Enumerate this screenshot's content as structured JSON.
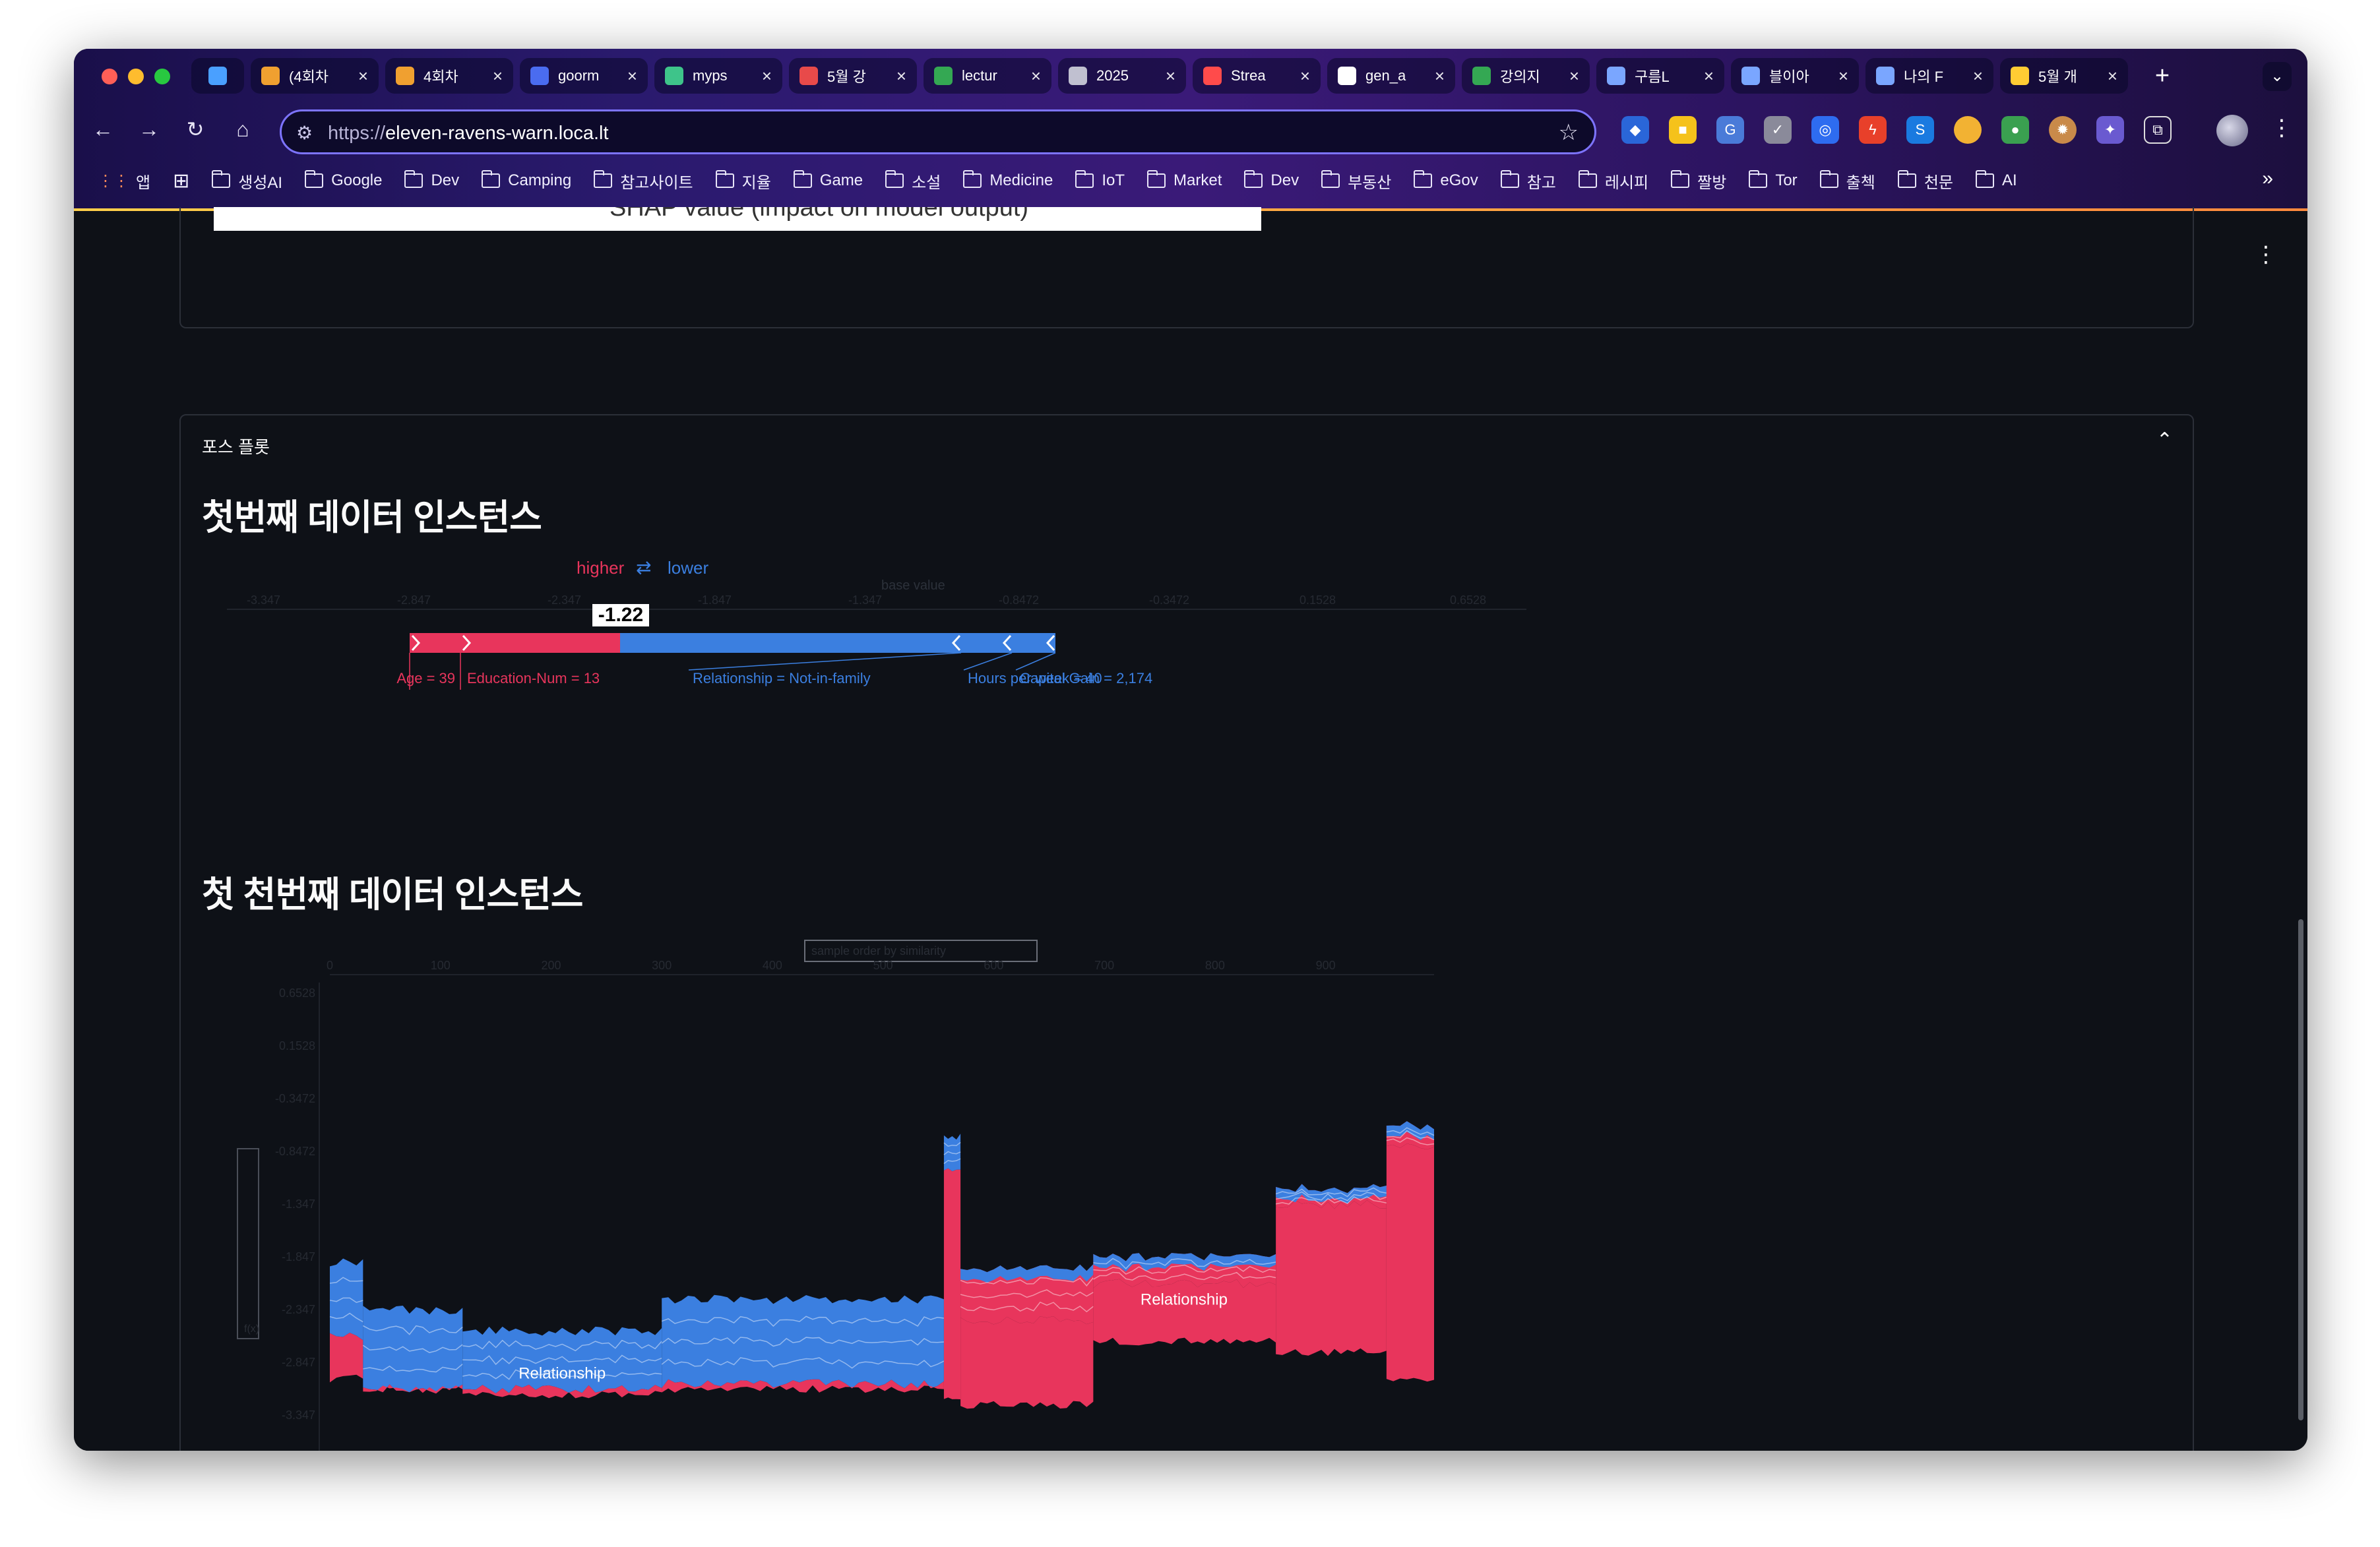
{
  "browser": {
    "tabs": [
      {
        "title": "",
        "icon_color": "#4aa0ff",
        "icon": "gem-icon",
        "pinned": true
      },
      {
        "title": "(4회차",
        "icon_color": "#f0a030",
        "icon": "cube-icon"
      },
      {
        "title": "4회차",
        "icon_color": "#f0a030",
        "icon": "cube-icon"
      },
      {
        "title": "goorm",
        "icon_color": "#4a6cf0",
        "icon": "goorm-icon"
      },
      {
        "title": "myps",
        "icon_color": "#3ec48a",
        "icon": "v-icon"
      },
      {
        "title": "5월 강",
        "icon_color": "#e84a4a",
        "icon": "hundred-icon"
      },
      {
        "title": "lectur",
        "icon_color": "#34a853",
        "icon": "drive-icon"
      },
      {
        "title": "2025",
        "icon_color": "#c0c0d0",
        "icon": "infinity-icon"
      },
      {
        "title": "Strea",
        "icon_color": "#ff4b4b",
        "icon": "crown-icon"
      },
      {
        "title": "gen_a",
        "icon_color": "#ffffff",
        "icon": "github-icon"
      },
      {
        "title": "강의지",
        "icon_color": "#34a853",
        "icon": "drive-icon"
      },
      {
        "title": "구름L",
        "icon_color": "#7aa6ff",
        "icon": "arrow-icon"
      },
      {
        "title": "블이아",
        "icon_color": "#7aa6ff",
        "icon": "arrow-icon"
      },
      {
        "title": "나의 F",
        "icon_color": "#7aa6ff",
        "icon": "arrow-icon"
      },
      {
        "title": "5월 개",
        "icon_color": "#ffcc33",
        "icon": "emoji-icon"
      }
    ],
    "close_glyph": "×",
    "new_tab_glyph": "+",
    "url_protocol": "https://",
    "url_host": "eleven-ravens-warn.loca.lt",
    "bookmarks": [
      "앱",
      "",
      "생성AI",
      "Google",
      "Dev",
      "Camping",
      "참고사이트",
      "지율",
      "Game",
      "소설",
      "Medicine",
      "IoT",
      "Market",
      "Dev",
      "부동산",
      "eGov",
      "참고",
      "레시피",
      "짤방",
      "Tor",
      "출첵",
      "천문",
      "AI"
    ],
    "bookmarks_more": "»"
  },
  "page": {
    "prev_image_caption": "SHAP value (impact on model output)",
    "expander_label": "포스 플롯",
    "section1_title": "첫번째 데이터 인스턴스",
    "section2_title": "첫 천번째 데이터 인스턴스",
    "colors": {
      "positive": "#e8355c",
      "negative": "#3b7fe0",
      "bg": "#0e1117",
      "text": "#fafafa"
    }
  },
  "chart_data": [
    {
      "type": "force",
      "legend_higher": "higher",
      "legend_arrows": "⇄",
      "legend_lower": "lower",
      "base_value_label": "base value",
      "output_value": "-1.22",
      "axis_ticks": [
        "-3.347",
        "-2.847",
        "-2.347",
        "-1.847",
        "-1.347",
        "-0.8472",
        "-0.3472",
        "0.1528",
        "0.6528"
      ],
      "positive_features": [
        {
          "label": "Age = 39",
          "value": 0.35
        },
        {
          "label": "Education-Num = 13",
          "value": 1.1
        }
      ],
      "negative_features": [
        {
          "label": "Relationship = Not-in-family",
          "value": 2.35
        },
        {
          "label": "Hours per week = 40",
          "value": 0.35
        },
        {
          "label": "Capital Gain = 2,174",
          "value": 0.3
        }
      ]
    },
    {
      "type": "area",
      "x_ticks": [
        "0",
        "100",
        "200",
        "300",
        "400",
        "500",
        "600",
        "700",
        "800",
        "900"
      ],
      "y_ticks": [
        "-3.347",
        "-2.847",
        "-2.347",
        "-1.847",
        "-1.347",
        "-0.8472",
        "-0.3472",
        "0.1528",
        "0.6528"
      ],
      "select_label": "sample order by similarity",
      "side_select_label": "f(x)",
      "region_labels": [
        "Relationship",
        "Relationship"
      ],
      "segments": [
        {
          "x0": 0,
          "x1": 30,
          "top": -1.9,
          "mid": -2.6,
          "bot": -3.0
        },
        {
          "x0": 30,
          "x1": 120,
          "top": -2.35,
          "mid": -3.1,
          "bot": -3.1
        },
        {
          "x0": 120,
          "x1": 300,
          "top": -2.55,
          "mid": -3.1,
          "bot": -3.15
        },
        {
          "x0": 300,
          "x1": 555,
          "top": -2.25,
          "mid": -3.05,
          "bot": -3.1
        },
        {
          "x0": 555,
          "x1": 570,
          "top": -0.7,
          "mid": -1.0,
          "bot": -3.2
        },
        {
          "x0": 570,
          "x1": 690,
          "top": -1.95,
          "mid": -2.45,
          "bot": -3.25
        },
        {
          "x0": 690,
          "x1": 855,
          "top": -1.85,
          "mid": -2.1,
          "bot": -2.65
        },
        {
          "x0": 855,
          "x1": 955,
          "top": -1.2,
          "mid": -1.35,
          "bot": -2.75
        },
        {
          "x0": 955,
          "x1": 998,
          "top": -0.6,
          "mid": -0.8,
          "bot": -3.0
        }
      ]
    }
  ]
}
